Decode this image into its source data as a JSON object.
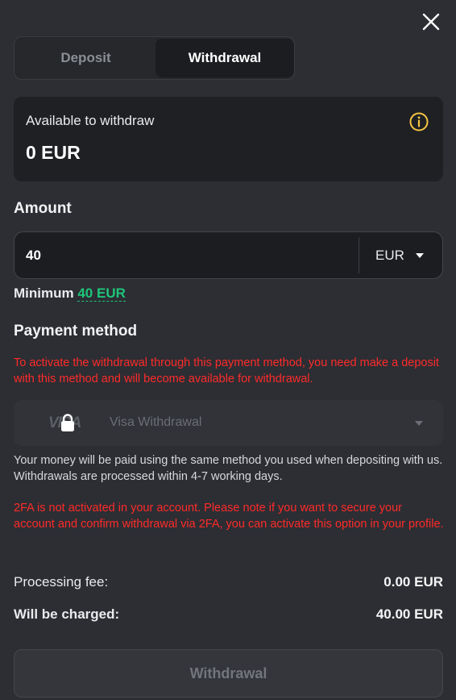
{
  "tabs": [
    {
      "label": "Deposit",
      "active": false
    },
    {
      "label": "Withdrawal",
      "active": true
    }
  ],
  "available": {
    "label": "Available to withdraw",
    "value": "0 EUR",
    "icon": "info-icon"
  },
  "amount": {
    "title": "Amount",
    "value": "40",
    "currency": "EUR"
  },
  "minimum": {
    "label": "Minimum",
    "value": "40 EUR"
  },
  "payment": {
    "title": "Payment method",
    "warning": "To activate the withdrawal through this payment method, you need make a deposit with this method and will become available for withdrawal.",
    "method_logo": "VISA",
    "method_label": "Visa Withdrawal",
    "note": "Your money will be paid using the same method you used when depositing with us. Withdrawals are processed within 4-7 working days.",
    "twofa_warning": "2FA is not activated in your account. Please note if you want to secure your account and confirm withdrawal via 2FA, you can activate this option in your profile."
  },
  "summary": {
    "fee_label": "Processing fee:",
    "fee_value": "0.00 EUR",
    "charged_label": "Will be charged:",
    "charged_value": "40.00 EUR"
  },
  "submit_label": "Withdrawal",
  "colors": {
    "background": "#2c2e33",
    "accent_green": "#1ec57a",
    "warning_red": "#ff2a2a",
    "info_yellow": "#f5c542"
  }
}
